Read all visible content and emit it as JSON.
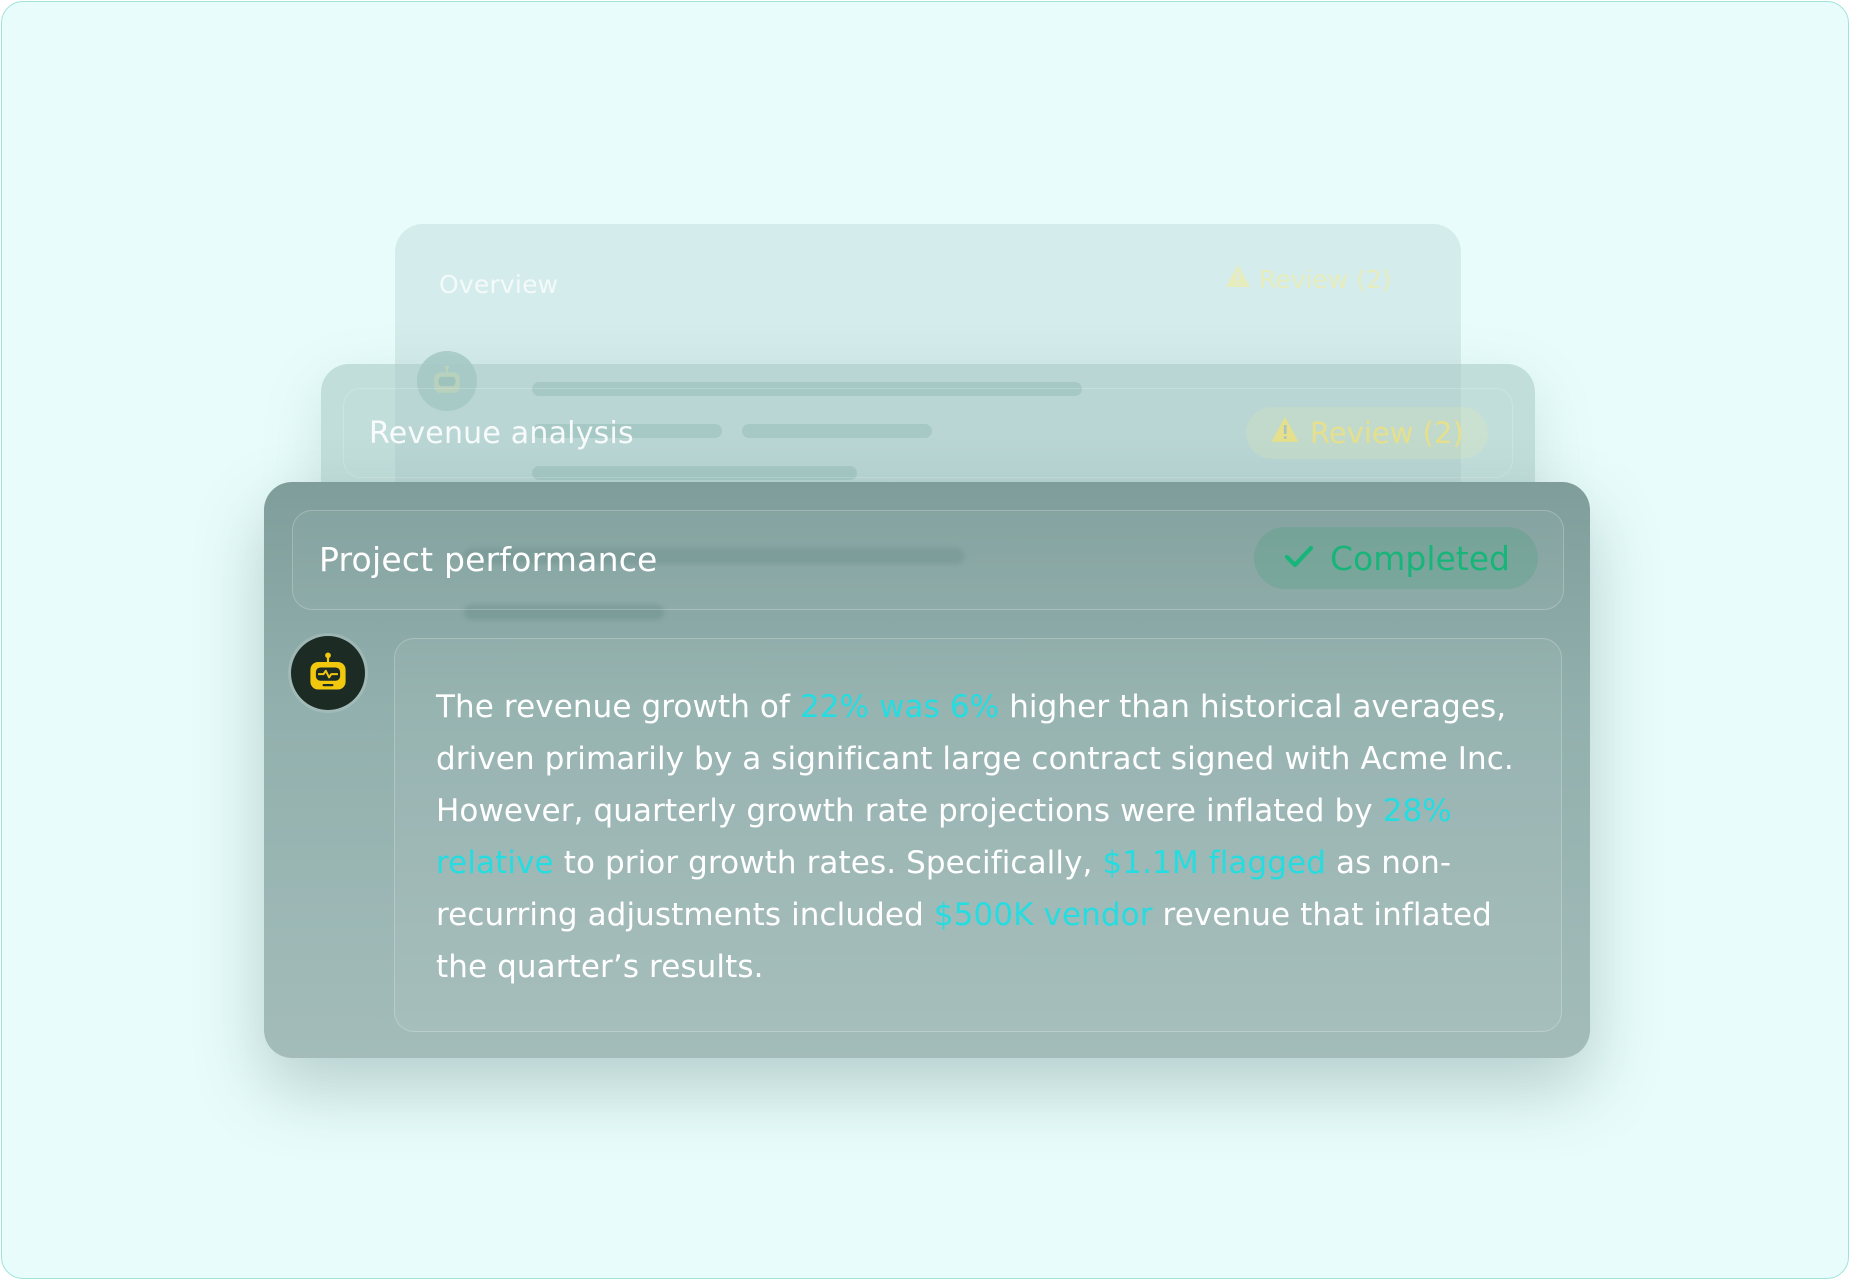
{
  "cards": {
    "back": {
      "title": "Overview",
      "badge": "Review (2)",
      "badge_icon": "warning-icon"
    },
    "middle": {
      "title": "Revenue analysis",
      "badge": "Review (2)",
      "badge_icon": "warning-icon"
    },
    "front": {
      "title": "Project performance",
      "badge": "Completed",
      "badge_icon": "check-icon",
      "avatar_icon": "robot-icon",
      "message": {
        "t1": "The revenue growth of ",
        "h1": "22% was 6%",
        "t2": " higher than historical averages, driven primarily by a significant large contract signed with Acme Inc. However, quarterly growth rate projections were inflated by ",
        "h2": "28% relative",
        "t3": " to prior growth rates. Specifically, ",
        "h3": "$1.1M flagged",
        "t4": " as non-recurring adjustments included ",
        "h4": "$500K vendor",
        "t5": " revenue that inflated the quarter’s results."
      }
    }
  },
  "colors": {
    "background": "#e8fcfb",
    "highlight": "#25dde0",
    "completed": "#18b57a",
    "review": "#e6e08d",
    "bot_avatar": "#1c2b24",
    "bot_face": "#f2c80f"
  }
}
